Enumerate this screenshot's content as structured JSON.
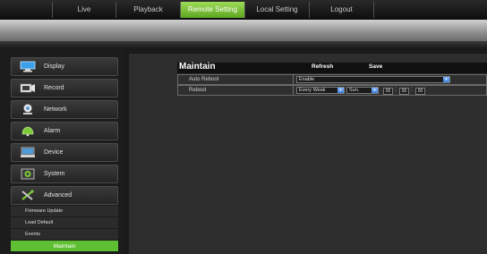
{
  "nav": {
    "tabs": [
      "Live",
      "Playback",
      "Remote Setting",
      "Local Setting",
      "Logout"
    ],
    "active_tab": "Remote Setting"
  },
  "sidebar": {
    "items": [
      {
        "label": "Display",
        "icon": "monitor-icon"
      },
      {
        "label": "Record",
        "icon": "record-icon"
      },
      {
        "label": "Network",
        "icon": "network-icon"
      },
      {
        "label": "Alarm",
        "icon": "alarm-icon"
      },
      {
        "label": "Device",
        "icon": "device-icon"
      },
      {
        "label": "System",
        "icon": "system-icon"
      },
      {
        "label": "Advanced",
        "icon": "tools-icon"
      }
    ],
    "subitems": [
      "Firmware Update",
      "Load Default",
      "Events",
      "Maintain"
    ],
    "active_subitem": "Maintain"
  },
  "maintain": {
    "title": "Maintain",
    "refresh_label": "Refresh",
    "save_label": "Save",
    "auto_reboot": {
      "label": "Auto Reboot",
      "value": "Enable"
    },
    "reboot": {
      "label": "Reboot",
      "frequency": "Every Week",
      "day": "Sun.",
      "hour": "00",
      "minute": "00",
      "second": "00"
    }
  },
  "colors": {
    "accent_green": "#5fbf32",
    "dropdown_arrow": "#3a7fe0",
    "background": "#1a1a1a"
  }
}
